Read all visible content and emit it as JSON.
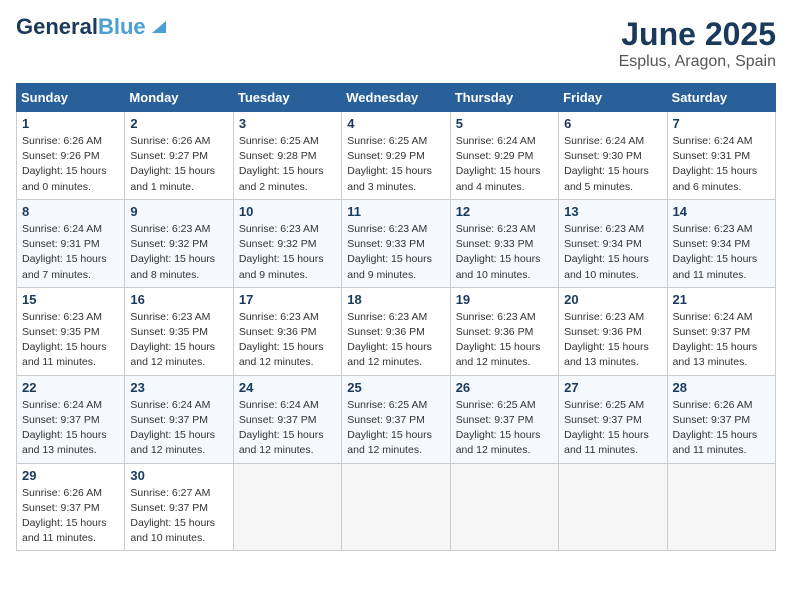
{
  "logo": {
    "line1": "General",
    "line2": "Blue"
  },
  "title": "June 2025",
  "subtitle": "Esplus, Aragon, Spain",
  "headers": [
    "Sunday",
    "Monday",
    "Tuesday",
    "Wednesday",
    "Thursday",
    "Friday",
    "Saturday"
  ],
  "weeks": [
    [
      {
        "day": "1",
        "sunrise": "Sunrise: 6:26 AM",
        "sunset": "Sunset: 9:26 PM",
        "daylight": "Daylight: 15 hours and 0 minutes."
      },
      {
        "day": "2",
        "sunrise": "Sunrise: 6:26 AM",
        "sunset": "Sunset: 9:27 PM",
        "daylight": "Daylight: 15 hours and 1 minute."
      },
      {
        "day": "3",
        "sunrise": "Sunrise: 6:25 AM",
        "sunset": "Sunset: 9:28 PM",
        "daylight": "Daylight: 15 hours and 2 minutes."
      },
      {
        "day": "4",
        "sunrise": "Sunrise: 6:25 AM",
        "sunset": "Sunset: 9:29 PM",
        "daylight": "Daylight: 15 hours and 3 minutes."
      },
      {
        "day": "5",
        "sunrise": "Sunrise: 6:24 AM",
        "sunset": "Sunset: 9:29 PM",
        "daylight": "Daylight: 15 hours and 4 minutes."
      },
      {
        "day": "6",
        "sunrise": "Sunrise: 6:24 AM",
        "sunset": "Sunset: 9:30 PM",
        "daylight": "Daylight: 15 hours and 5 minutes."
      },
      {
        "day": "7",
        "sunrise": "Sunrise: 6:24 AM",
        "sunset": "Sunset: 9:31 PM",
        "daylight": "Daylight: 15 hours and 6 minutes."
      }
    ],
    [
      {
        "day": "8",
        "sunrise": "Sunrise: 6:24 AM",
        "sunset": "Sunset: 9:31 PM",
        "daylight": "Daylight: 15 hours and 7 minutes."
      },
      {
        "day": "9",
        "sunrise": "Sunrise: 6:23 AM",
        "sunset": "Sunset: 9:32 PM",
        "daylight": "Daylight: 15 hours and 8 minutes."
      },
      {
        "day": "10",
        "sunrise": "Sunrise: 6:23 AM",
        "sunset": "Sunset: 9:32 PM",
        "daylight": "Daylight: 15 hours and 9 minutes."
      },
      {
        "day": "11",
        "sunrise": "Sunrise: 6:23 AM",
        "sunset": "Sunset: 9:33 PM",
        "daylight": "Daylight: 15 hours and 9 minutes."
      },
      {
        "day": "12",
        "sunrise": "Sunrise: 6:23 AM",
        "sunset": "Sunset: 9:33 PM",
        "daylight": "Daylight: 15 hours and 10 minutes."
      },
      {
        "day": "13",
        "sunrise": "Sunrise: 6:23 AM",
        "sunset": "Sunset: 9:34 PM",
        "daylight": "Daylight: 15 hours and 10 minutes."
      },
      {
        "day": "14",
        "sunrise": "Sunrise: 6:23 AM",
        "sunset": "Sunset: 9:34 PM",
        "daylight": "Daylight: 15 hours and 11 minutes."
      }
    ],
    [
      {
        "day": "15",
        "sunrise": "Sunrise: 6:23 AM",
        "sunset": "Sunset: 9:35 PM",
        "daylight": "Daylight: 15 hours and 11 minutes."
      },
      {
        "day": "16",
        "sunrise": "Sunrise: 6:23 AM",
        "sunset": "Sunset: 9:35 PM",
        "daylight": "Daylight: 15 hours and 12 minutes."
      },
      {
        "day": "17",
        "sunrise": "Sunrise: 6:23 AM",
        "sunset": "Sunset: 9:36 PM",
        "daylight": "Daylight: 15 hours and 12 minutes."
      },
      {
        "day": "18",
        "sunrise": "Sunrise: 6:23 AM",
        "sunset": "Sunset: 9:36 PM",
        "daylight": "Daylight: 15 hours and 12 minutes."
      },
      {
        "day": "19",
        "sunrise": "Sunrise: 6:23 AM",
        "sunset": "Sunset: 9:36 PM",
        "daylight": "Daylight: 15 hours and 12 minutes."
      },
      {
        "day": "20",
        "sunrise": "Sunrise: 6:23 AM",
        "sunset": "Sunset: 9:36 PM",
        "daylight": "Daylight: 15 hours and 13 minutes."
      },
      {
        "day": "21",
        "sunrise": "Sunrise: 6:24 AM",
        "sunset": "Sunset: 9:37 PM",
        "daylight": "Daylight: 15 hours and 13 minutes."
      }
    ],
    [
      {
        "day": "22",
        "sunrise": "Sunrise: 6:24 AM",
        "sunset": "Sunset: 9:37 PM",
        "daylight": "Daylight: 15 hours and 13 minutes."
      },
      {
        "day": "23",
        "sunrise": "Sunrise: 6:24 AM",
        "sunset": "Sunset: 9:37 PM",
        "daylight": "Daylight: 15 hours and 12 minutes."
      },
      {
        "day": "24",
        "sunrise": "Sunrise: 6:24 AM",
        "sunset": "Sunset: 9:37 PM",
        "daylight": "Daylight: 15 hours and 12 minutes."
      },
      {
        "day": "25",
        "sunrise": "Sunrise: 6:25 AM",
        "sunset": "Sunset: 9:37 PM",
        "daylight": "Daylight: 15 hours and 12 minutes."
      },
      {
        "day": "26",
        "sunrise": "Sunrise: 6:25 AM",
        "sunset": "Sunset: 9:37 PM",
        "daylight": "Daylight: 15 hours and 12 minutes."
      },
      {
        "day": "27",
        "sunrise": "Sunrise: 6:25 AM",
        "sunset": "Sunset: 9:37 PM",
        "daylight": "Daylight: 15 hours and 11 minutes."
      },
      {
        "day": "28",
        "sunrise": "Sunrise: 6:26 AM",
        "sunset": "Sunset: 9:37 PM",
        "daylight": "Daylight: 15 hours and 11 minutes."
      }
    ],
    [
      {
        "day": "29",
        "sunrise": "Sunrise: 6:26 AM",
        "sunset": "Sunset: 9:37 PM",
        "daylight": "Daylight: 15 hours and 11 minutes."
      },
      {
        "day": "30",
        "sunrise": "Sunrise: 6:27 AM",
        "sunset": "Sunset: 9:37 PM",
        "daylight": "Daylight: 15 hours and 10 minutes."
      },
      null,
      null,
      null,
      null,
      null
    ]
  ]
}
